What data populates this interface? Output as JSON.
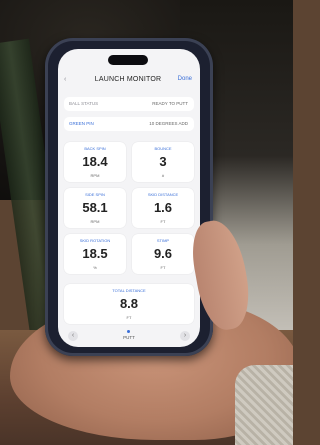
{
  "header": {
    "title": "LAUNCH MONITOR",
    "done": "Done",
    "back": "‹"
  },
  "status": {
    "ball_status_label": "BALL STATUS",
    "ball_status_value": "READY TO PUTT",
    "green_pin_label": "GREEN PIN",
    "green_pin_value": "10 DEGREES ADD"
  },
  "cards": [
    {
      "label": "BACK SPIN",
      "value": "18.4",
      "unit": "RPM"
    },
    {
      "label": "BOUNCE",
      "value": "3",
      "unit": "#"
    },
    {
      "label": "SIDE SPIN",
      "value": "58.1",
      "unit": "RPM"
    },
    {
      "label": "SKID DISTANCE",
      "value": "1.6",
      "unit": "FT"
    },
    {
      "label": "SKID ROTATION",
      "value": "18.5",
      "unit": "%"
    },
    {
      "label": "STIMP",
      "value": "9.6",
      "unit": "FT"
    }
  ],
  "total": {
    "label": "TOTAL DISTANCE",
    "value": "8.8",
    "unit": "FT"
  },
  "footer": {
    "page": "PUTT",
    "prev": "‹",
    "next": "›"
  }
}
